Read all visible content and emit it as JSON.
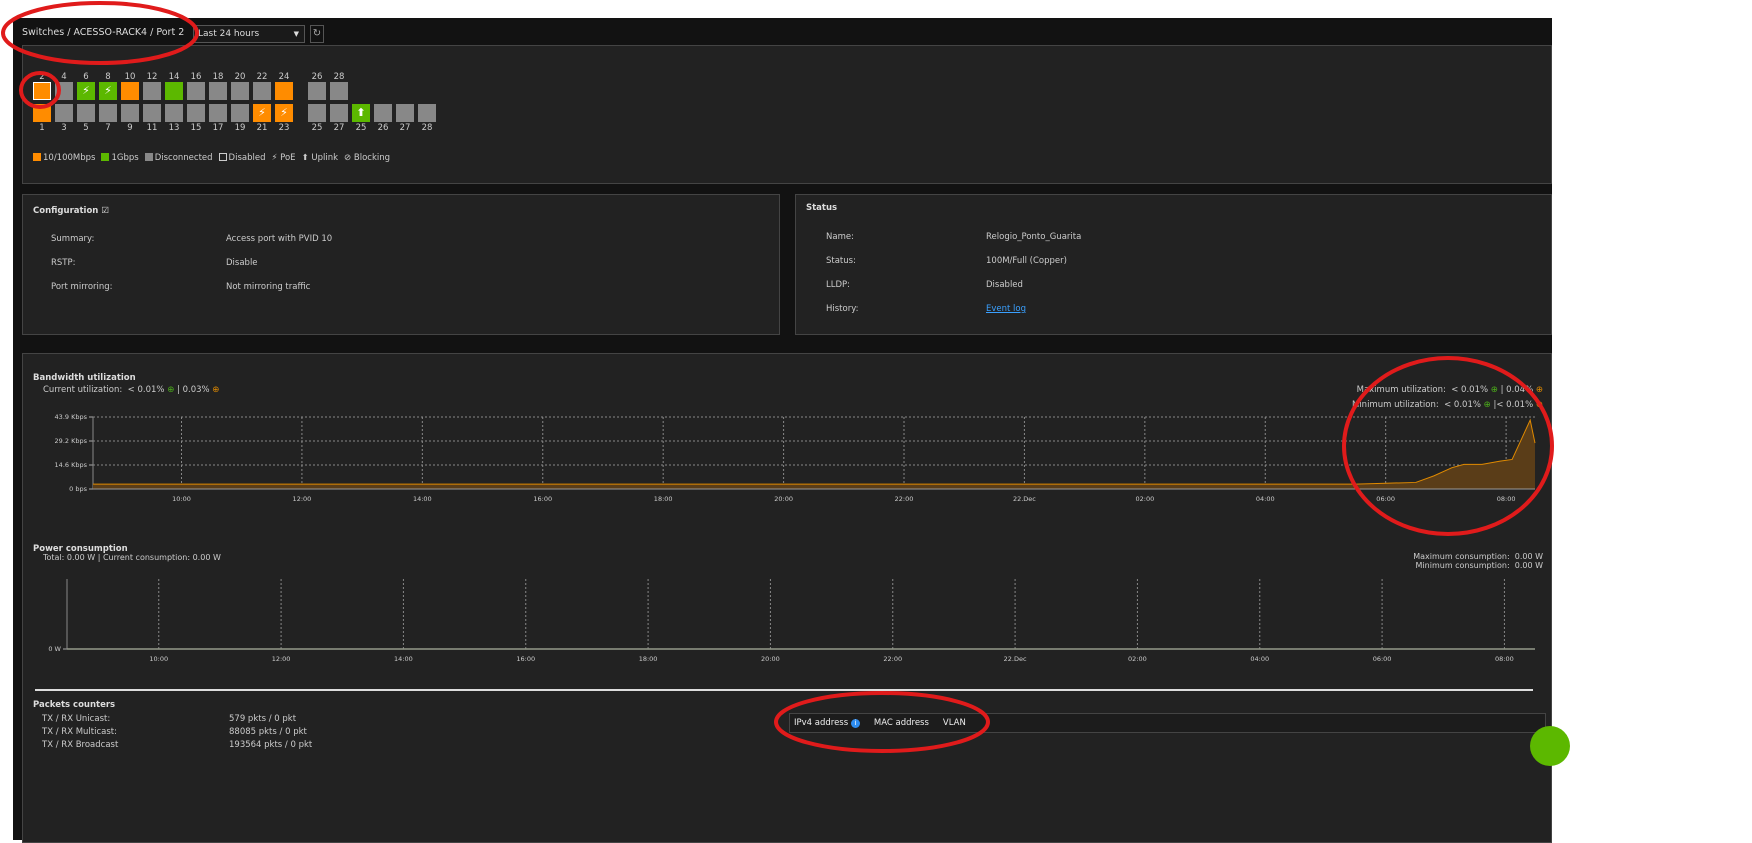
{
  "header": {
    "breadcrumb": "Switches  /  ACESSO-RACK4  /  Port 2",
    "time_range": "Last 24 hours",
    "refresh_icon": "refresh-icon"
  },
  "colors": {
    "speed_10_100": "#ff8c00",
    "speed_1g": "#5cb800",
    "disconnected": "#888888",
    "background": "#222222"
  },
  "ports": {
    "top": [
      {
        "n": "2",
        "s": "o",
        "selected": true
      },
      {
        "n": "4",
        "s": "d"
      },
      {
        "n": "6",
        "s": "g",
        "poe": true
      },
      {
        "n": "8",
        "s": "g",
        "poe": true
      },
      {
        "n": "10",
        "s": "o"
      },
      {
        "n": "12",
        "s": "d"
      },
      {
        "n": "14",
        "s": "g"
      },
      {
        "n": "16",
        "s": "d"
      },
      {
        "n": "18",
        "s": "d"
      },
      {
        "n": "20",
        "s": "d"
      },
      {
        "n": "22",
        "s": "d"
      },
      {
        "n": "24",
        "s": "o"
      },
      {
        "n": "26",
        "s": "d"
      },
      {
        "n": "28",
        "s": "d"
      }
    ],
    "bottom": [
      {
        "n": "1",
        "s": "o"
      },
      {
        "n": "3",
        "s": "d"
      },
      {
        "n": "5",
        "s": "d"
      },
      {
        "n": "7",
        "s": "d"
      },
      {
        "n": "9",
        "s": "d"
      },
      {
        "n": "11",
        "s": "d"
      },
      {
        "n": "13",
        "s": "d"
      },
      {
        "n": "15",
        "s": "d"
      },
      {
        "n": "17",
        "s": "d"
      },
      {
        "n": "19",
        "s": "d"
      },
      {
        "n": "21",
        "s": "o",
        "poe": true
      },
      {
        "n": "23",
        "s": "o",
        "poe": true
      },
      {
        "n": "25",
        "s": "d"
      },
      {
        "n": "27",
        "s": "d"
      },
      {
        "n": "25",
        "s": "g",
        "uplink": true
      },
      {
        "n": "26",
        "s": "d"
      },
      {
        "n": "27",
        "s": "d"
      },
      {
        "n": "28",
        "s": "d"
      }
    ],
    "legend": [
      "10/100Mbps",
      "1Gbps",
      "Disconnected",
      "Disabled",
      "PoE",
      "Uplink",
      "Blocking"
    ]
  },
  "configuration": {
    "title": "Configuration",
    "rows": [
      {
        "label": "Summary:",
        "value": "Access port with PVID 10"
      },
      {
        "label": "RSTP:",
        "value": "Disable"
      },
      {
        "label": "Port mirroring:",
        "value": "Not mirroring traffic"
      }
    ]
  },
  "status": {
    "title": "Status",
    "rows": [
      {
        "label": "Name:",
        "value": "Relogio_Ponto_Guarita"
      },
      {
        "label": "Status:",
        "value": "100M/Full (Copper)"
      },
      {
        "label": "LLDP:",
        "value": "Disabled"
      },
      {
        "label": "History:",
        "value": "Event log"
      }
    ]
  },
  "bandwidth": {
    "title": "Bandwidth utilization",
    "current_label": "Current utilization:",
    "current_down": "< 0.01%",
    "current_up": "| 0.03%",
    "max_label": "Maximum utilization:",
    "max_down": "< 0.01%",
    "max_up": "| 0.04%",
    "min_label": "Minimum utilization:",
    "min_down": "< 0.01%",
    "min_up": "|< 0.01%"
  },
  "power": {
    "title": "Power consumption",
    "summary": "Total: 0.00 W | Current consumption: 0.00 W",
    "max_label": "Maximum consumption:",
    "max_value": "0.00 W",
    "min_label": "Minimum consumption:",
    "min_value": "0.00 W"
  },
  "packets": {
    "title": "Packets counters",
    "rows": [
      {
        "label": "TX / RX Unicast:",
        "value": "579 pkts / 0 pkt"
      },
      {
        "label": "TX / RX Multicast:",
        "value": "88085 pkts / 0 pkt"
      },
      {
        "label": "TX / RX Broadcast",
        "value": "193564 pkts / 0 pkt"
      }
    ]
  },
  "address_table": {
    "columns": [
      "IPv4 address",
      "MAC address",
      "VLAN"
    ]
  },
  "chart_data": [
    {
      "type": "area",
      "ylabel": "",
      "yticks": [
        "0 bps",
        "14.6 Kbps",
        "29.2 Kbps",
        "43.9 Kbps"
      ],
      "ylim": [
        0,
        43.9
      ],
      "unit": "Kbps",
      "xticks": [
        "10:00",
        "12:00",
        "14:00",
        "16:00",
        "18:00",
        "20:00",
        "22:00",
        "22.Dec",
        "02:00",
        "04:00",
        "06:00",
        "08:00"
      ],
      "xlim_hours": [
        -1.47,
        22.48
      ],
      "grid": true,
      "color": "#e08a00",
      "x_hours": [
        -1.47,
        0,
        2,
        4,
        6,
        8,
        10,
        12,
        14,
        16,
        18,
        19.5,
        20,
        20.5,
        20.8,
        21.1,
        21.3,
        21.6,
        21.9,
        22.1,
        22.4,
        22.48
      ],
      "values": [
        3,
        3,
        3,
        3,
        3,
        3,
        3,
        3,
        3,
        3,
        3,
        3,
        3.5,
        4,
        8,
        13,
        15,
        15,
        17,
        18,
        42,
        28
      ]
    },
    {
      "type": "line",
      "yticks": [
        "0 W"
      ],
      "ylim": [
        0,
        1
      ],
      "unit": "W",
      "xticks": [
        "10:00",
        "12:00",
        "14:00",
        "16:00",
        "18:00",
        "20:00",
        "22:00",
        "22.Dec",
        "02:00",
        "04:00",
        "06:00",
        "08:00"
      ],
      "grid": true,
      "x_hours": [
        -1.5,
        22.5
      ],
      "values": [
        0,
        0
      ]
    }
  ]
}
